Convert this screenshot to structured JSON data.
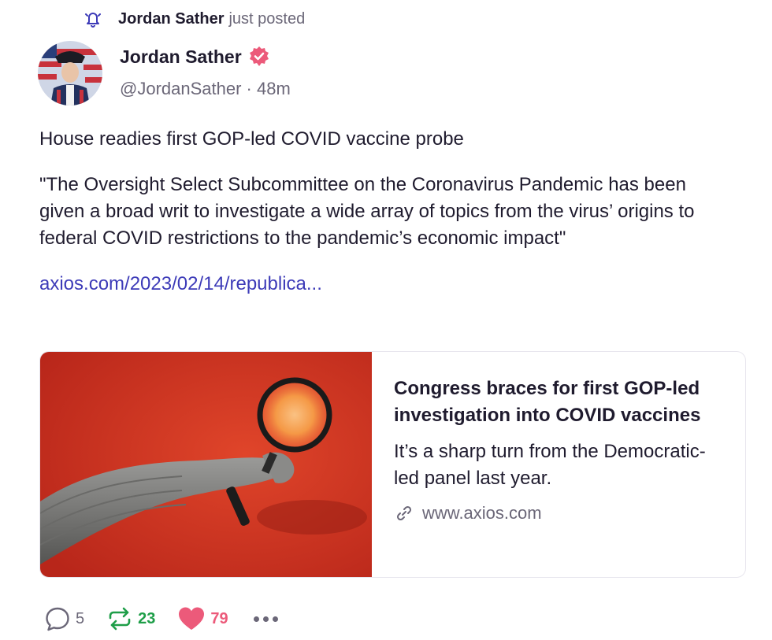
{
  "notice": {
    "author": "Jordan Sather",
    "action": "just posted",
    "icon": "bell-icon"
  },
  "post": {
    "author_name": "Jordan Sather",
    "handle": "@JordanSather",
    "separator": "·",
    "age": "48m",
    "verified": true,
    "headline": "House readies first GOP-led COVID vaccine probe",
    "quote": "\"The Oversight Select Subcommittee on the Coronavirus Pandemic has been given a broad writ to investigate a wide array of topics from the virus’ origins to federal COVID restrictions to the pandemic’s economic impact\"",
    "link": "axios.com/2023/02/14/republica..."
  },
  "card": {
    "title": "Congress braces for first GOP-led investigation into COVID vaccines",
    "description": "It’s a sharp turn from the Democratic-led panel last year.",
    "domain": "www.axios.com"
  },
  "actions": {
    "replies": "5",
    "reposts": "23",
    "likes": "79"
  },
  "colors": {
    "accent": "#3d3bb8",
    "verified": "#ec5a7a",
    "repost": "#1e9e48",
    "like": "#ec5a7a"
  }
}
